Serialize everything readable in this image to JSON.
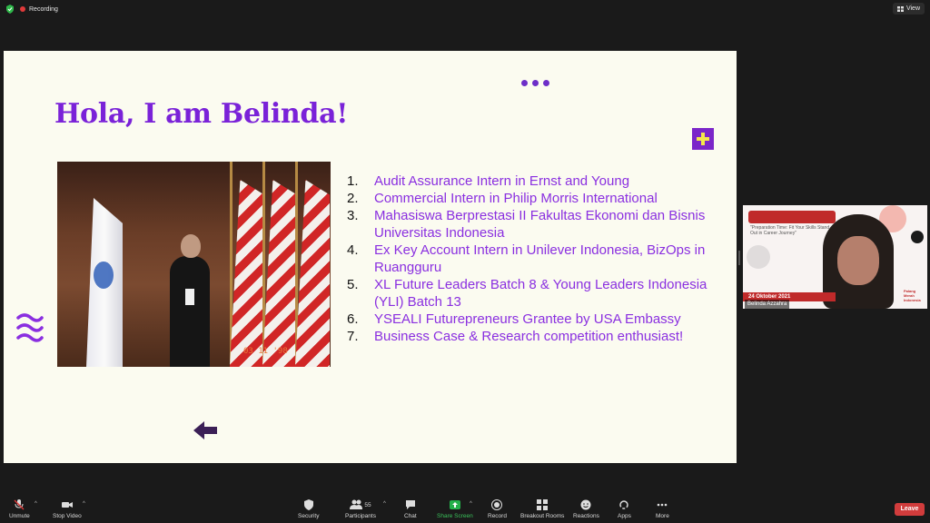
{
  "topbar": {
    "recording_label": "Recording",
    "view_label": "View"
  },
  "slide": {
    "title": "Hola, I am Belinda!",
    "photo_stamp": "03 11 '98",
    "items": [
      {
        "num": "1.",
        "text": "Audit Assurance Intern in Ernst and Young"
      },
      {
        "num": "2.",
        "text": "Commercial Intern in Philip Morris International"
      },
      {
        "num": "3.",
        "text": "Mahasiswa Berprestasi II Fakultas Ekonomi dan Bisnis Universitas Indonesia"
      },
      {
        "num": "4.",
        "text": "Ex Key Account Intern in Unilever Indonesia, BizOps in Ruangguru"
      },
      {
        "num": "5.",
        "text": "XL Future Leaders Batch 8 & Young Leaders Indonesia (YLI) Batch 13"
      },
      {
        "num": "6.",
        "text": "YSEALI Futurepreneurs Grantee by USA Embassy"
      },
      {
        "num": "7.",
        "text": "Business Case & Research competition enthusiast!"
      }
    ],
    "colors": {
      "title": "#7a22d8",
      "items": "#8a2fe0",
      "accent": "#f4e94a"
    }
  },
  "selfview": {
    "poster_subtitle": "\"Preparation Time: Fit Your Skills Stand Out in Career Journey\"",
    "date": "24 Oktober 2021",
    "name": "Belinda Azzahra",
    "org_text": "Palang Merah Indonesia"
  },
  "toolbar": {
    "unmute": "Unmute",
    "stop_video": "Stop Video",
    "security": "Security",
    "participants": "Participants",
    "participants_count": "55",
    "chat": "Chat",
    "share_screen": "Share Screen",
    "record": "Record",
    "breakout_rooms": "Breakout Rooms",
    "reactions": "Reactions",
    "apps": "Apps",
    "more": "More",
    "leave": "Leave"
  }
}
